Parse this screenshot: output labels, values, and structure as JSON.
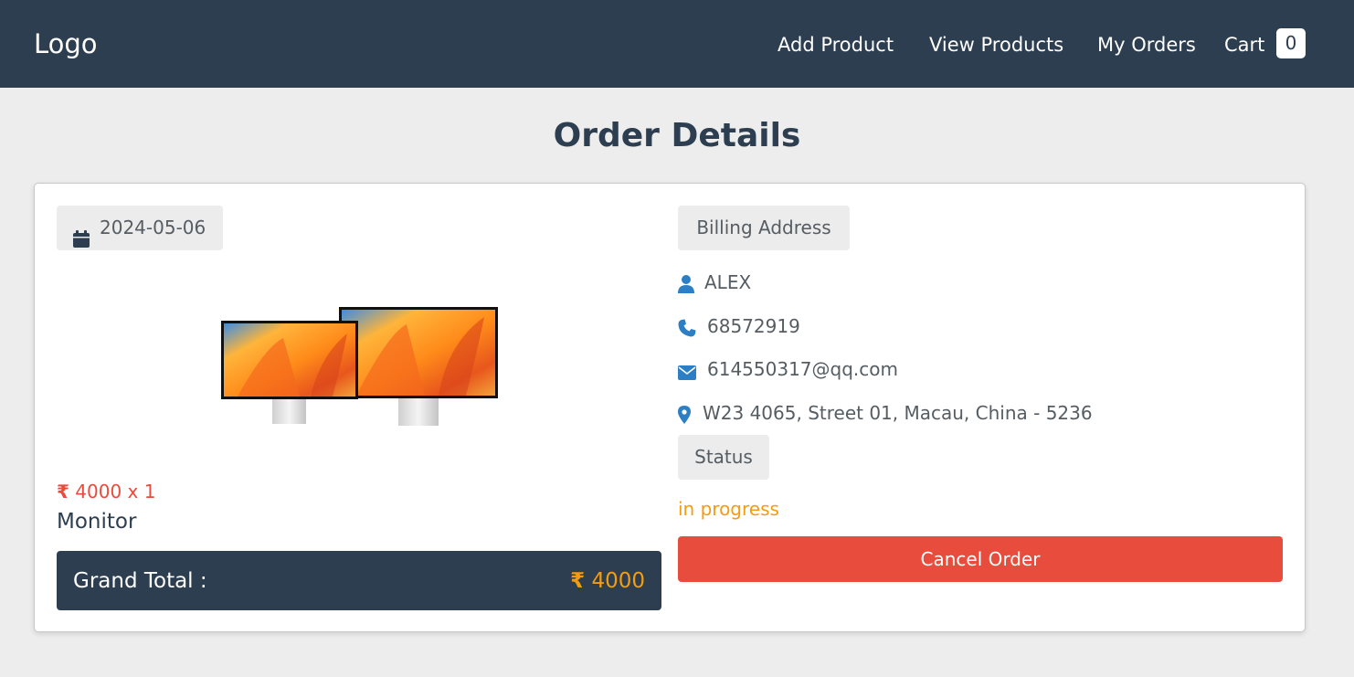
{
  "navbar": {
    "logo": "Logo",
    "links": [
      "Add Product",
      "View Products",
      "My Orders",
      "Cart"
    ],
    "cart_count": "0"
  },
  "page": {
    "title": "Order Details"
  },
  "order": {
    "date": "2024-05-06",
    "product": {
      "image": "monitor-pair-image",
      "currency_symbol": "₹",
      "price_qty": "4000 x 1",
      "name": "Monitor"
    },
    "grand_total": {
      "label": "Grand Total :",
      "currency_symbol": "₹",
      "value": "4000"
    }
  },
  "billing": {
    "heading": "Billing Address",
    "name": "ALEX",
    "phone": "68572919",
    "email": "614550317@qq.com",
    "address": "W23 4065, Street 01, Macau, China - 5236"
  },
  "status": {
    "heading": "Status",
    "value": "in progress"
  },
  "actions": {
    "cancel_label": "Cancel Order"
  },
  "colors": {
    "navbar_bg": "#2c3e50",
    "accent_red": "#e74c3c",
    "accent_orange": "#f39c12",
    "icon_blue": "#2c7fc4",
    "page_bg": "#ededed"
  },
  "icons": [
    "calendar-icon",
    "user-icon",
    "phone-icon",
    "envelope-icon",
    "map-pin-icon"
  ]
}
